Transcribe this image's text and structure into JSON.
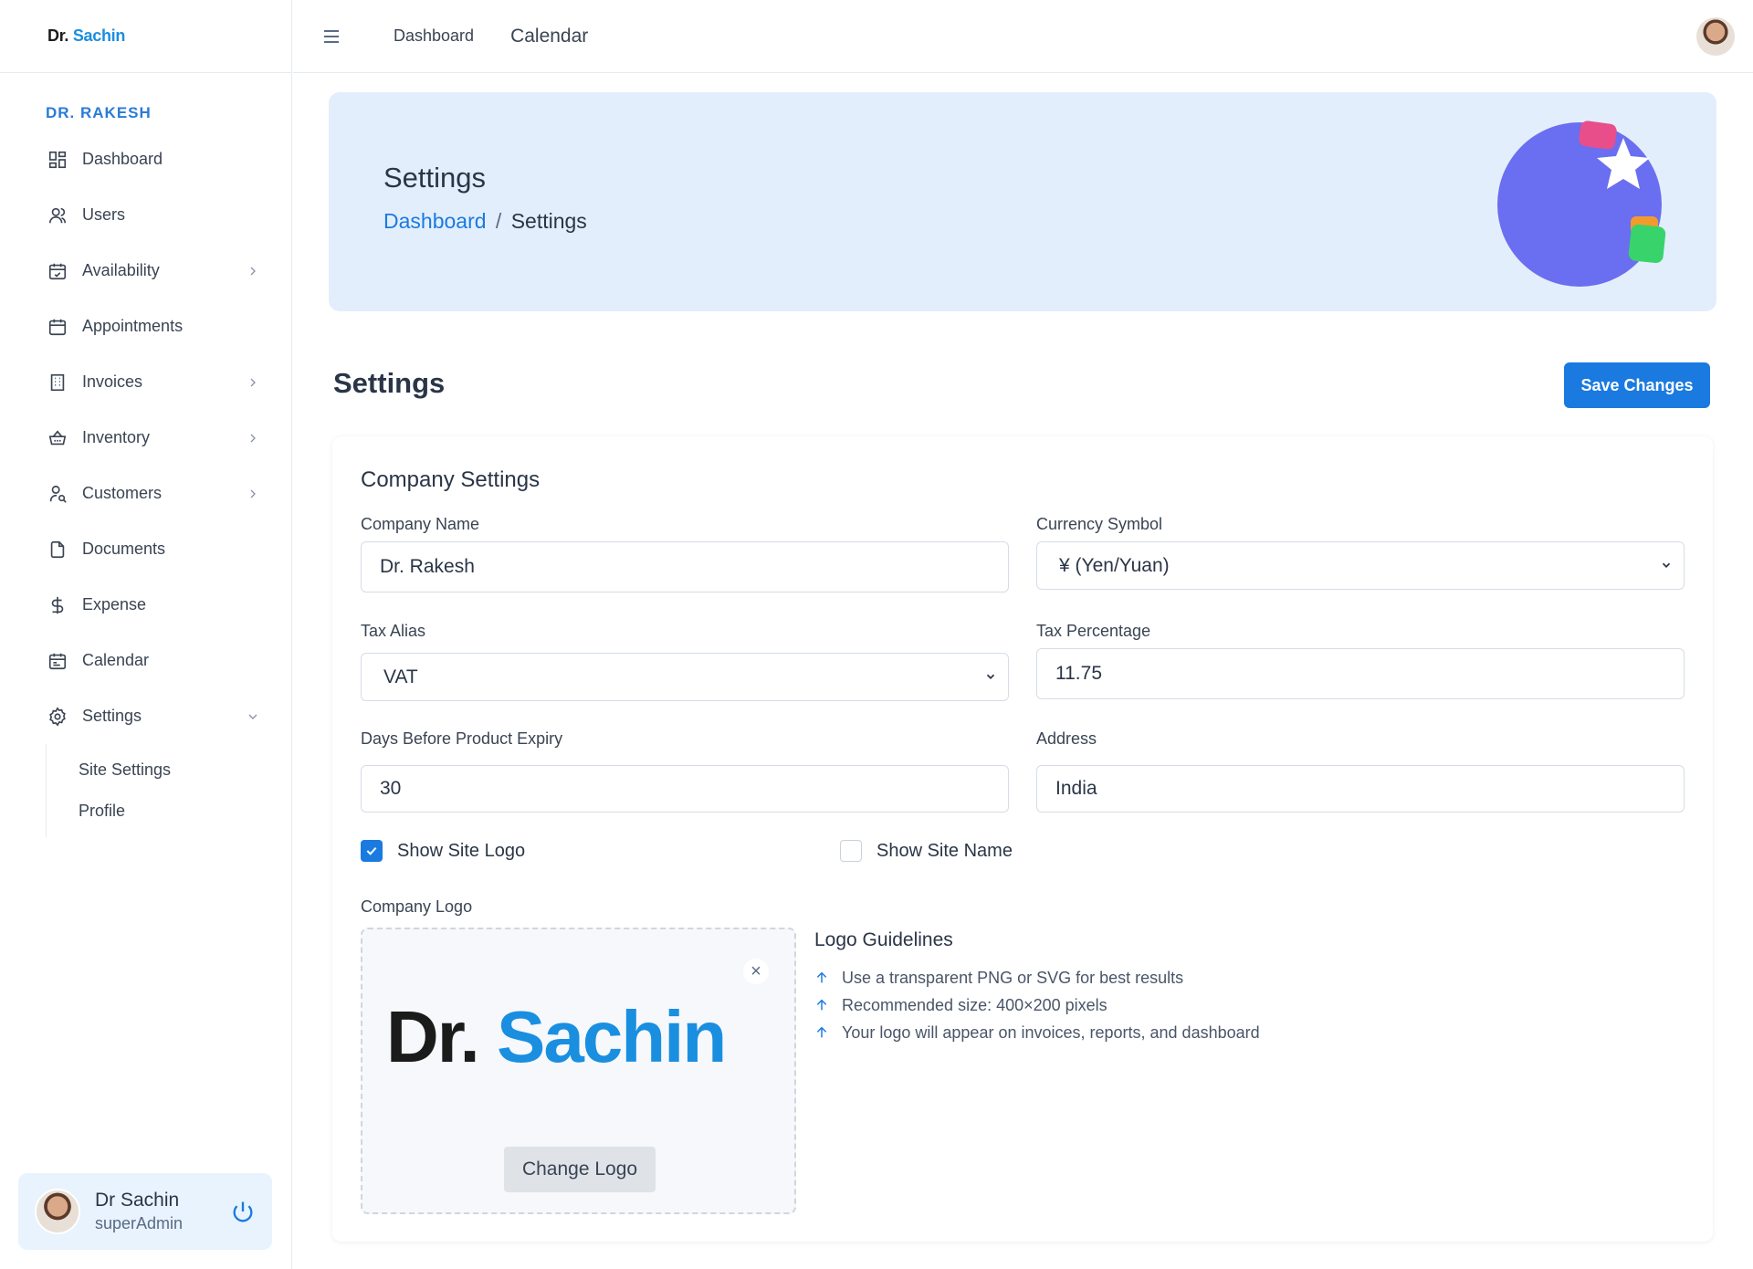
{
  "brand": {
    "dr": "Dr.",
    "name": "Sachin"
  },
  "sidebar": {
    "section_title": "DR. RAKESH",
    "items": [
      {
        "label": "Dashboard",
        "icon": "dashboard-grid-icon",
        "has_chevron": false
      },
      {
        "label": "Users",
        "icon": "user-icon",
        "has_chevron": false
      },
      {
        "label": "Availability",
        "icon": "calendar-check-icon",
        "has_chevron": true
      },
      {
        "label": "Appointments",
        "icon": "calendar-icon",
        "has_chevron": false
      },
      {
        "label": "Invoices",
        "icon": "building-icon",
        "has_chevron": true
      },
      {
        "label": "Inventory",
        "icon": "basket-icon",
        "has_chevron": true
      },
      {
        "label": "Customers",
        "icon": "user-search-icon",
        "has_chevron": true
      },
      {
        "label": "Documents",
        "icon": "file-icon",
        "has_chevron": false
      },
      {
        "label": "Expense",
        "icon": "dollar-icon",
        "has_chevron": false
      },
      {
        "label": "Calendar",
        "icon": "calendar-event-icon",
        "has_chevron": false
      },
      {
        "label": "Settings",
        "icon": "gear-icon",
        "has_chevron": true,
        "expanded": true
      }
    ],
    "sub_items": [
      "Site Settings",
      "Profile"
    ]
  },
  "user": {
    "name": "Dr Sachin",
    "role": "superAdmin"
  },
  "topbar": {
    "links": [
      "Dashboard",
      "Calendar"
    ]
  },
  "banner": {
    "title": "Settings",
    "breadcrumb_link": "Dashboard",
    "breadcrumb_sep": "/",
    "breadcrumb_current": "Settings"
  },
  "page": {
    "heading": "Settings",
    "save_label": "Save Changes"
  },
  "form": {
    "title": "Company Settings",
    "company_name_label": "Company Name",
    "company_name_value": "Dr. Rakesh",
    "currency_label": "Currency Symbol",
    "currency_value": "¥ (Yen/Yuan)",
    "tax_alias_label": "Tax Alias",
    "tax_alias_value": "VAT",
    "tax_pct_label": "Tax Percentage",
    "tax_pct_value": "11.75",
    "expiry_label": "Days Before Product Expiry",
    "expiry_value": "30",
    "address_label": "Address",
    "address_value": "India",
    "show_logo_label": "Show Site Logo",
    "show_logo_checked": true,
    "show_name_label": "Show Site Name",
    "show_name_checked": false,
    "logo_label": "Company Logo",
    "change_logo_label": "Change Logo",
    "close_glyph": "×"
  },
  "guidelines": {
    "title": "Logo Guidelines",
    "items": [
      "Use a transparent PNG or SVG for best results",
      "Recommended size: 400×200 pixels",
      "Your logo will appear on invoices, reports, and dashboard"
    ]
  },
  "colors": {
    "accent": "#1a7ae0",
    "banner_bg": "#e3eefc",
    "art_purple": "#6a6ef0"
  }
}
